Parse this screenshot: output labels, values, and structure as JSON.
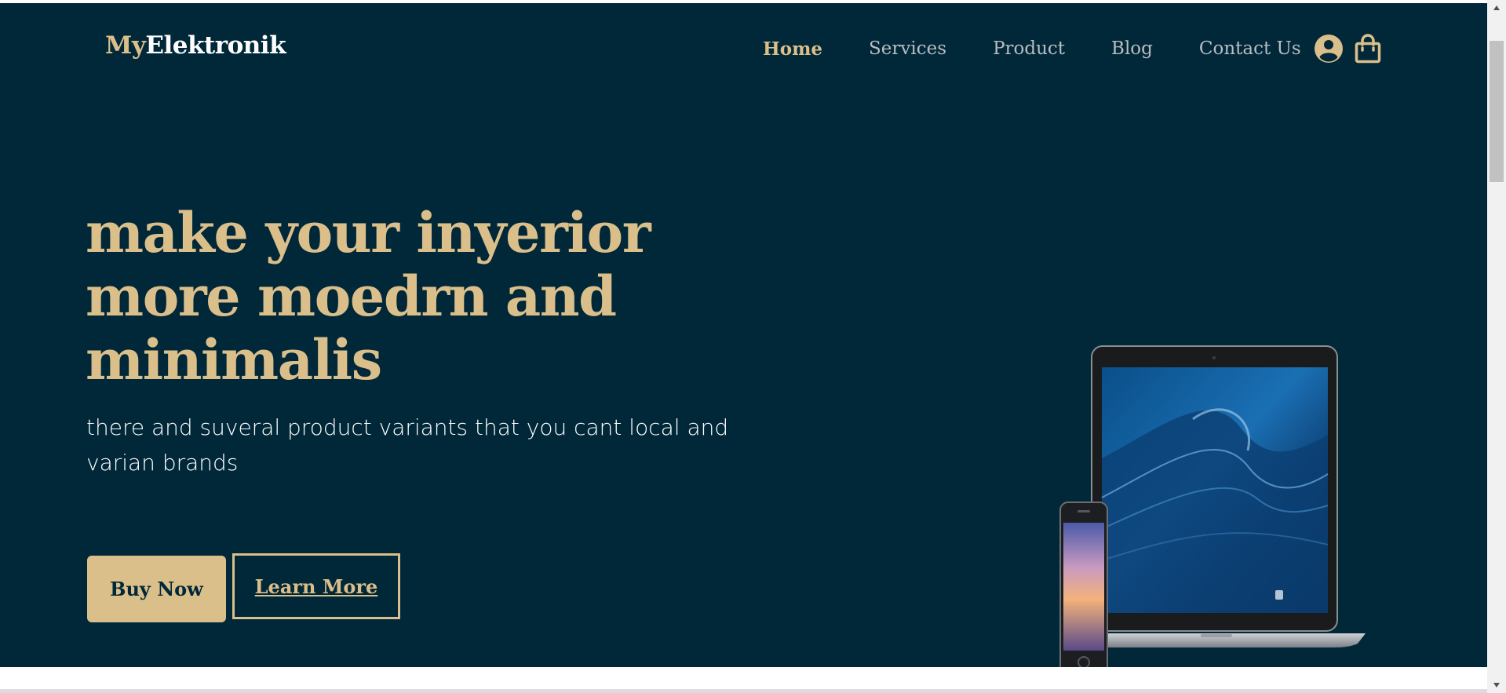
{
  "brand": {
    "prefix": "My",
    "suffix": "Elektronik"
  },
  "nav": {
    "items": [
      {
        "label": "Home",
        "active": true
      },
      {
        "label": "Services",
        "active": false
      },
      {
        "label": "Product",
        "active": false
      },
      {
        "label": "Blog",
        "active": false
      },
      {
        "label": "Contact Us",
        "active": false
      }
    ],
    "icons": [
      "user-circle-icon",
      "shopping-bag-icon"
    ]
  },
  "hero": {
    "headline_lines": [
      "make your inyerior",
      "more moedrn and",
      "minimalis"
    ],
    "subtext_lines": [
      "there and suveral product variants that you cant local and",
      "varian brands"
    ],
    "primary_button": "Buy Now",
    "secondary_button": "Learn More",
    "image": "laptop-and-phone-devices"
  },
  "colors": {
    "background": "#012839",
    "accent": "#dbbf8b",
    "nav_text": "#b9bdc2",
    "text": "#ffffff"
  }
}
